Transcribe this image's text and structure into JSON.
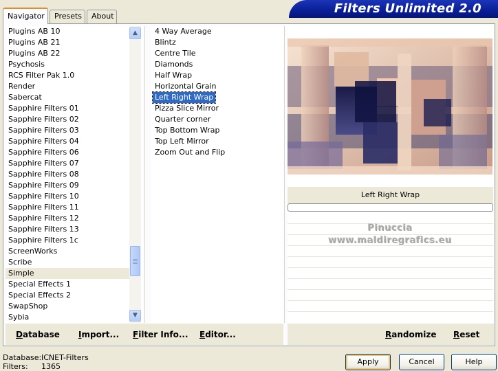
{
  "tabs": [
    {
      "label": "Navigator",
      "active": true
    },
    {
      "label": "Presets",
      "active": false
    },
    {
      "label": "About",
      "active": false
    }
  ],
  "title": "Filters Unlimited 2.0",
  "categories": [
    "Plugins AB 10",
    "Plugins AB 21",
    "Plugins AB 22",
    "Psychosis",
    "RCS Filter Pak 1.0",
    "Render",
    "Sabercat",
    "Sapphire Filters 01",
    "Sapphire Filters 02",
    "Sapphire Filters 03",
    "Sapphire Filters 04",
    "Sapphire Filters 06",
    "Sapphire Filters 07",
    "Sapphire Filters 08",
    "Sapphire Filters 09",
    "Sapphire Filters 10",
    "Sapphire Filters 11",
    "Sapphire Filters 12",
    "Sapphire Filters 13",
    "Sapphire Filters 1c",
    "ScreenWorks",
    "Scribe",
    "Simple",
    "Special Effects 1",
    "Special Effects 2",
    "SwapShop",
    "Sybia"
  ],
  "selected_category": "Simple",
  "filters": [
    "4 Way Average",
    "Blintz",
    "Centre Tile",
    "Diamonds",
    "Half Wrap",
    "Horizontal Grain",
    "Left Right Wrap",
    "Pizza Slice Mirror",
    "Quarter corner",
    "Top Bottom Wrap",
    "Top Left Mirror",
    "Zoom Out and Flip"
  ],
  "selected_filter": "Left Right Wrap",
  "preview": {
    "filter_name": "Left Right Wrap",
    "watermark_line1": "Pinuccia",
    "watermark_line2": "www.maldiregrafics.eu"
  },
  "toolbar_left": {
    "database": "Database",
    "import": "Import...",
    "filter_info": "Filter Info...",
    "editor": "Editor..."
  },
  "toolbar_right": {
    "randomize": "Randomize",
    "reset": "Reset"
  },
  "footer": {
    "database_label": "Database:",
    "database_value": "ICNET-Filters",
    "filters_label": "Filters:",
    "filters_value": "1365"
  },
  "buttons": {
    "apply": "Apply",
    "cancel": "Cancel",
    "help": "Help"
  },
  "colors": {
    "title_blue": "#0a1f95",
    "selection_blue": "#316ac5",
    "dialog_bg": "#ece9d8"
  }
}
